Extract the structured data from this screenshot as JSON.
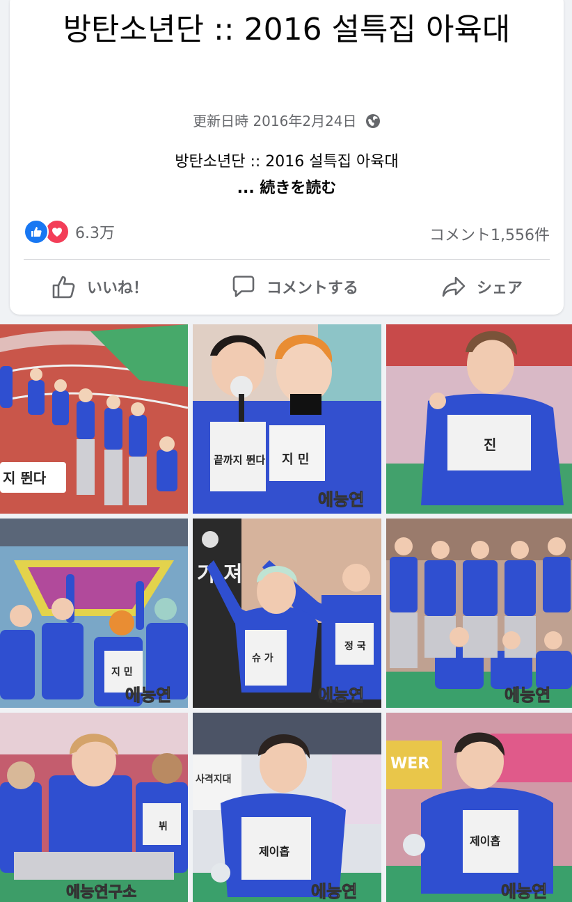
{
  "post": {
    "title": "방탄소년단 :: 2016 설특집 아육대",
    "updated_label": "更新日時 2016年2月24日",
    "privacy_icon": "globe-icon",
    "description": "방탄소년단 :: 2016 설특집 아육대",
    "see_more": "... 続きを読む"
  },
  "reactions": {
    "icons": [
      "like-icon",
      "love-icon"
    ],
    "count": "6.3万",
    "comments": "コメント1,556件"
  },
  "actions": [
    {
      "label": "いいね！",
      "icon": "thumbs-up-icon"
    },
    {
      "label": "コメントする",
      "icon": "comment-icon"
    },
    {
      "label": "シェア",
      "icon": "share-icon"
    }
  ],
  "photos": {
    "count": 9,
    "badges": [
      {
        "text": "에능연"
      },
      {
        "text": "에능연"
      },
      {
        "text": "에능연"
      },
      {
        "text": "에능연구소"
      },
      {
        "text": "에능연"
      }
    ],
    "bibs": {
      "p1": "지 뛴다",
      "p2a": "끝까지 뛴다",
      "p2b": "지 민",
      "p3": "진",
      "p4": "지 민",
      "p5a": "정 국",
      "p5b": "슈 가",
      "p7": "뷔",
      "p8": "제이홉",
      "p9": "제이홉"
    },
    "signs": {
      "p5": "가 져",
      "p8": "사격지대",
      "p9": "WER"
    }
  },
  "colors": {
    "accent": "#1877f2",
    "love": "#f33e58",
    "text_secondary": "#65676b",
    "jersey_blue": "#2f4fd0"
  }
}
